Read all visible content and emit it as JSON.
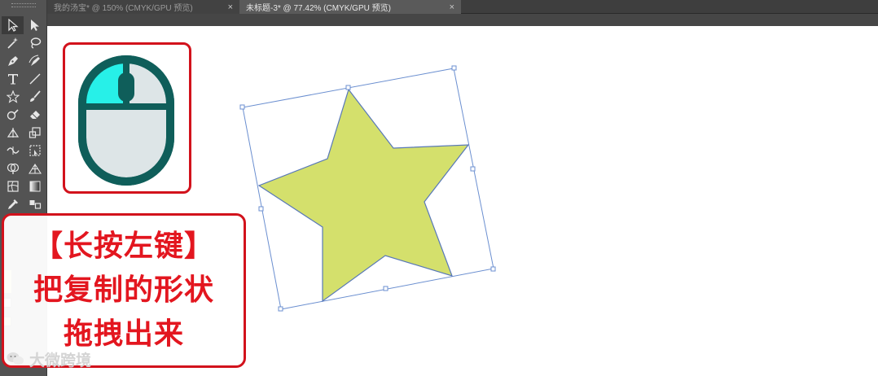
{
  "tabs": [
    {
      "label": "我的汤宝* @ 150% (CMYK/GPU 预览)",
      "close": "×"
    },
    {
      "label": "未标题-3* @ 77.42% (CMYK/GPU 预览)",
      "close": "×"
    }
  ],
  "toolbar": {
    "tools": [
      "selection-tool",
      "direct-selection-tool",
      "magic-wand-tool",
      "lasso-tool",
      "pen-tool",
      "curvature-tool",
      "type-tool",
      "line-segment-tool",
      "star-tool",
      "paintbrush-tool",
      "shaper-tool",
      "eraser-tool",
      "rotate-tool",
      "scale-tool",
      "width-tool",
      "free-transform-tool",
      "shape-builder-tool",
      "perspective-grid-tool",
      "mesh-tool",
      "gradient-tool",
      "eyedropper-tool",
      "blend-tool"
    ],
    "fill_color": "#d4e06c"
  },
  "colors": {
    "accent_red": "#e3161f",
    "star_fill": "#d4e06c",
    "mouse_dark": "#0f5e5a",
    "mouse_light": "#dde5e7",
    "mouse_cyan": "#27f0e8"
  },
  "caption": {
    "line1": "【长按左键】",
    "line2": "把复制的形状",
    "line3": "拖拽出来"
  },
  "watermark": {
    "text": "大微跨境",
    "icon": "wechat-icon"
  }
}
